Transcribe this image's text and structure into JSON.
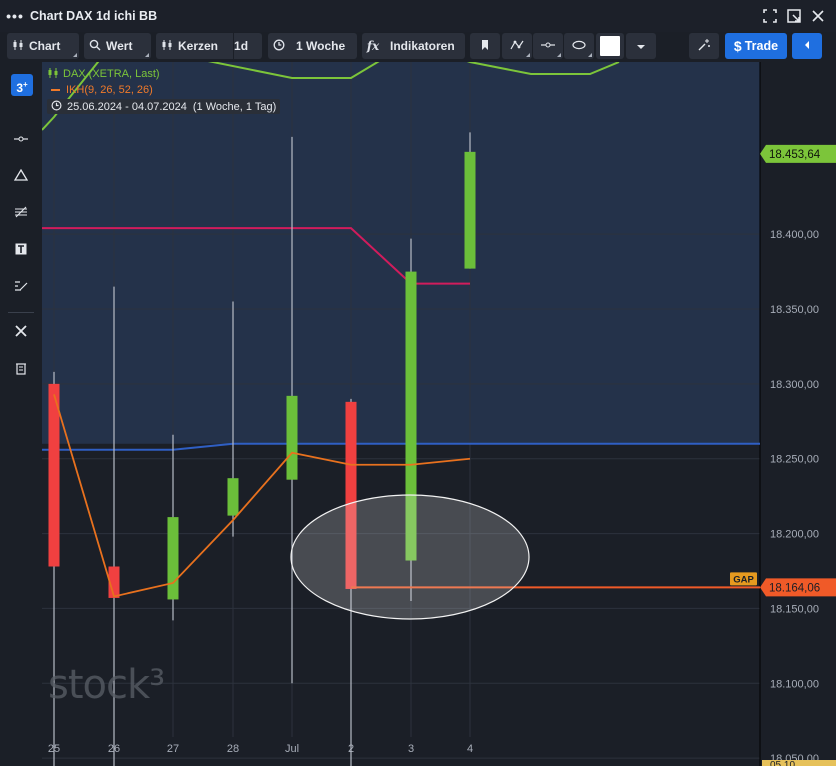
{
  "window": {
    "title": "Chart DAX 1d ichi BB"
  },
  "toolbar": {
    "chart_label": "Chart",
    "value_label": "Wert",
    "candles_label": "Kerzen",
    "interval_label": "1d",
    "range_label": "1 Woche",
    "indicators_label": "Indikatoren",
    "trade_label": "Trade",
    "color_swatch": "#ffffff"
  },
  "legend": {
    "instrument": "DAX (XETRA, Last)",
    "indicator": "IKH(9, 26, 52, 26)",
    "date_range": "25.06.2024 - 04.07.2024",
    "range_note": "(1 Woche, 1 Tag)"
  },
  "watermark": "stock³",
  "colors": {
    "up": "#6bbf3a",
    "down": "#f04040",
    "kijun": "#e8711e",
    "senkou_b": "#d11c5c",
    "bb_mid": "#2f5fc4",
    "bb_upper": "#7cc53a",
    "gap": "#f05a28",
    "cloud": "#24324a"
  },
  "chart_data": {
    "type": "candlestick",
    "x": [
      "25",
      "26",
      "27",
      "28",
      "Jul",
      "2",
      "3",
      "4"
    ],
    "ylim": [
      18030,
      18475
    ],
    "yticks": [
      "18.050,00",
      "18.100,00",
      "18.150,00",
      "18.200,00",
      "18.250,00",
      "18.300,00",
      "18.350,00",
      "18.400,00"
    ],
    "ohlc": [
      {
        "o": 18300,
        "h": 18308,
        "l": 18040,
        "c": 18178
      },
      {
        "o": 18178,
        "h": 18365,
        "l": 18030,
        "c": 18157
      },
      {
        "o": 18156,
        "h": 18266,
        "l": 18142,
        "c": 18211
      },
      {
        "o": 18212,
        "h": 18355,
        "l": 18198,
        "c": 18237
      },
      {
        "o": 18236,
        "h": 18465,
        "l": 18100,
        "c": 18292
      },
      {
        "o": 18288,
        "h": 18290,
        "l": 18040,
        "c": 18163
      },
      {
        "o": 18182,
        "h": 18397,
        "l": 18155,
        "c": 18375
      },
      {
        "o": 18377,
        "h": 18468,
        "l": 18377,
        "c": 18455
      }
    ],
    "series": [
      {
        "name": "IKH(9, 26, 52, 26)",
        "values": [
          18293,
          18158,
          18167,
          18209,
          18254,
          18246,
          18246,
          18250
        ]
      },
      {
        "values": [
          18404,
          18404,
          18404,
          18404,
          18404,
          18404,
          18367,
          18367
        ]
      },
      {
        "values": [
          18256,
          18256,
          18256,
          18260,
          18260,
          18260,
          18260,
          18260
        ]
      },
      {
        "values": [
          18438,
          18475,
          18495,
          18510,
          18520,
          18520,
          18500,
          18495
        ]
      }
    ],
    "last_price": "18.453,64",
    "gap_price": "18.164,06",
    "gap_value": 18164.06,
    "gap_label": "GAP",
    "bottom_partial_label": "05 10"
  }
}
